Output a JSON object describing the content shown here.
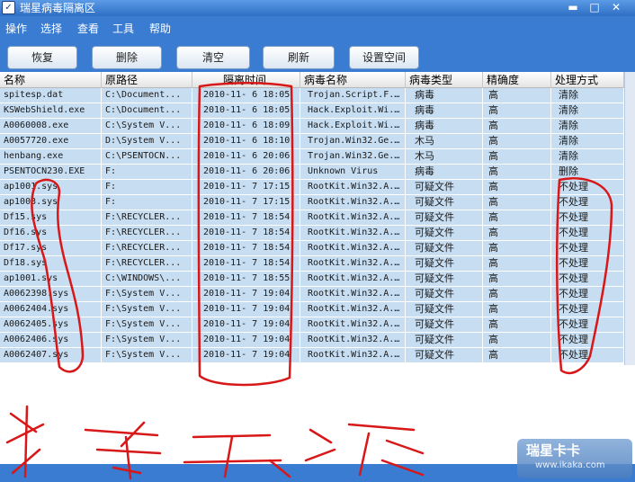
{
  "window": {
    "title": "瑞星病毒隔离区",
    "controls": {
      "minimize": "▬",
      "maximize": "□",
      "close": "✕"
    }
  },
  "menu": [
    "操作",
    "选择",
    "查看",
    "工具",
    "帮助"
  ],
  "toolbar": [
    "恢复",
    "删除",
    "清空",
    "刷新",
    "设置空间"
  ],
  "table": {
    "columns": [
      "名称",
      "原路径",
      "隔离时间",
      "病毒名称",
      "病毒类型",
      "精确度",
      "处理方式"
    ],
    "rows": [
      [
        "spitesp.dat",
        "C:\\Document...",
        "2010-11- 6 18:05",
        "Trojan.Script.F...",
        "病毒",
        "高",
        "清除"
      ],
      [
        "KSWebShield.exe",
        "C:\\Document...",
        "2010-11- 6 18:05",
        "Hack.Exploit.Wi...",
        "病毒",
        "高",
        "清除"
      ],
      [
        "A0060008.exe",
        "C:\\System V...",
        "2010-11- 6 18:09",
        "Hack.Exploit.Wi...",
        "病毒",
        "高",
        "清除"
      ],
      [
        "A0057720.exe",
        "D:\\System V...",
        "2010-11- 6 18:10",
        "Trojan.Win32.Ge...",
        "木马",
        "高",
        "清除"
      ],
      [
        "henbang.exe",
        "C:\\PSENTOCN...",
        "2010-11- 6 20:06",
        "Trojan.Win32.Ge...",
        "木马",
        "高",
        "清除"
      ],
      [
        "PSENTOCN230.EXE",
        "F:",
        "2010-11- 6 20:06",
        "Unknown Virus",
        "病毒",
        "高",
        "删除"
      ],
      [
        "ap1001.sys",
        "F:",
        "2010-11- 7 17:15",
        "RootKit.Win32.A...",
        "可疑文件",
        "高",
        "不处理"
      ],
      [
        "ap1003.sys",
        "F:",
        "2010-11- 7 17:15",
        "RootKit.Win32.A...",
        "可疑文件",
        "高",
        "不处理"
      ],
      [
        "Df15.sys",
        "F:\\RECYCLER...",
        "2010-11- 7 18:54",
        "RootKit.Win32.A...",
        "可疑文件",
        "高",
        "不处理"
      ],
      [
        "Df16.sys",
        "F:\\RECYCLER...",
        "2010-11- 7 18:54",
        "RootKit.Win32.A...",
        "可疑文件",
        "高",
        "不处理"
      ],
      [
        "Df17.sys",
        "F:\\RECYCLER...",
        "2010-11- 7 18:54",
        "RootKit.Win32.A...",
        "可疑文件",
        "高",
        "不处理"
      ],
      [
        "Df18.sys",
        "F:\\RECYCLER...",
        "2010-11- 7 18:54",
        "RootKit.Win32.A...",
        "可疑文件",
        "高",
        "不处理"
      ],
      [
        "ap1001.sys",
        "C:\\WINDOWS\\...",
        "2010-11- 7 18:55",
        "RootKit.Win32.A...",
        "可疑文件",
        "高",
        "不处理"
      ],
      [
        "A0062398.sys",
        "F:\\System V...",
        "2010-11- 7 19:04",
        "RootKit.Win32.A...",
        "可疑文件",
        "高",
        "不处理"
      ],
      [
        "A0062404.sys",
        "F:\\System V...",
        "2010-11- 7 19:04",
        "RootKit.Win32.A...",
        "可疑文件",
        "高",
        "不处理"
      ],
      [
        "A0062405.sys",
        "F:\\System V...",
        "2010-11- 7 19:04",
        "RootKit.Win32.A...",
        "可疑文件",
        "高",
        "不处理"
      ],
      [
        "A0062406.sys",
        "F:\\System V...",
        "2010-11- 7 19:04",
        "RootKit.Win32.A...",
        "可疑文件",
        "高",
        "不处理"
      ],
      [
        "A0062407.sys",
        "F:\\System V...",
        "2010-11- 7 19:04",
        "RootKit.Win32.A...",
        "可疑文件",
        "高",
        "不处理"
      ]
    ]
  },
  "watermark": {
    "brand": "瑞星卡卡",
    "url": "www.ikaka.com"
  },
  "colors": {
    "annotation": "#d81818",
    "row": "#c6ddf2",
    "chrome": "#3a7cd2"
  }
}
